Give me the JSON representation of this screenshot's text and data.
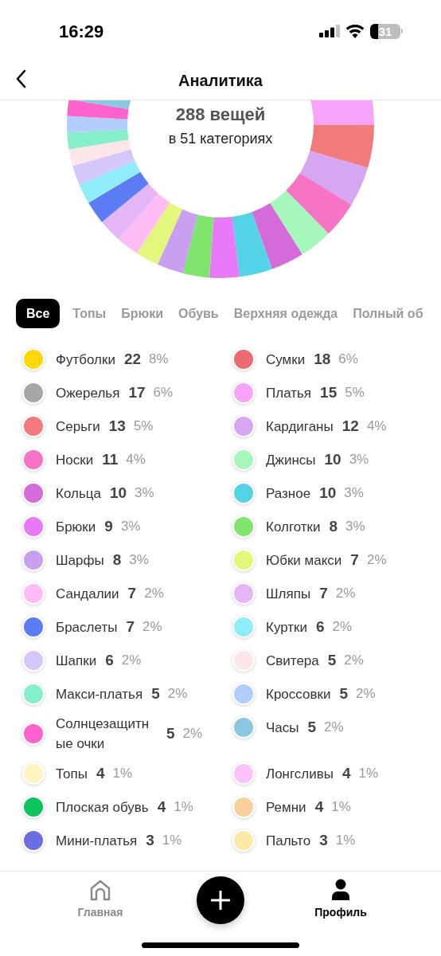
{
  "status_bar": {
    "time": "16:29",
    "battery": "31"
  },
  "header": {
    "title": "Аналитика"
  },
  "summary": {
    "total": "288 вещей",
    "categories": "в 51 категориях"
  },
  "tabs": [
    {
      "label": "Все",
      "selected": true
    },
    {
      "label": "Топы",
      "selected": false
    },
    {
      "label": "Брюки",
      "selected": false
    },
    {
      "label": "Обувь",
      "selected": false
    },
    {
      "label": "Верхняя одежда",
      "selected": false
    },
    {
      "label": "Полный об",
      "selected": false
    }
  ],
  "categories": [
    {
      "name": "Футболки",
      "count": "22",
      "percent": "8%",
      "color": "#ffd60a"
    },
    {
      "name": "Сумки",
      "count": "18",
      "percent": "6%",
      "color": "#ea6b6f"
    },
    {
      "name": "Ожерелья",
      "count": "17",
      "percent": "6%",
      "color": "#a6a6a6"
    },
    {
      "name": "Платья",
      "count": "15",
      "percent": "5%",
      "color": "#f7a3f9"
    },
    {
      "name": "Серьги",
      "count": "13",
      "percent": "5%",
      "color": "#f27a7d"
    },
    {
      "name": "Кардиганы",
      "count": "12",
      "percent": "4%",
      "color": "#d5a6f2"
    },
    {
      "name": "Носки",
      "count": "11",
      "percent": "4%",
      "color": "#f774c4"
    },
    {
      "name": "Джинсы",
      "count": "10",
      "percent": "3%",
      "color": "#a6f7bc"
    },
    {
      "name": "Кольца",
      "count": "10",
      "percent": "3%",
      "color": "#d46bd9"
    },
    {
      "name": "Разное",
      "count": "10",
      "percent": "3%",
      "color": "#55d3e6"
    },
    {
      "name": "Брюки",
      "count": "9",
      "percent": "3%",
      "color": "#e879f9"
    },
    {
      "name": "Колготки",
      "count": "8",
      "percent": "3%",
      "color": "#7fe56d"
    },
    {
      "name": "Шарфы",
      "count": "8",
      "percent": "3%",
      "color": "#c9a0ef"
    },
    {
      "name": "Юбки макси",
      "count": "7",
      "percent": "2%",
      "color": "#e3f77a"
    },
    {
      "name": "Сандалии",
      "count": "7",
      "percent": "2%",
      "color": "#fdbcf4"
    },
    {
      "name": "Шляпы",
      "count": "7",
      "percent": "2%",
      "color": "#e4b6f5"
    },
    {
      "name": "Браслеты",
      "count": "7",
      "percent": "2%",
      "color": "#5b7cf5"
    },
    {
      "name": "Куртки",
      "count": "6",
      "percent": "2%",
      "color": "#8fedf9"
    },
    {
      "name": "Шапки",
      "count": "6",
      "percent": "2%",
      "color": "#d4c8fb"
    },
    {
      "name": "Свитера",
      "count": "5",
      "percent": "2%",
      "color": "#fde6e8"
    },
    {
      "name": "Макси-платья",
      "count": "5",
      "percent": "2%",
      "color": "#85efca"
    },
    {
      "name": "Кроссовки",
      "count": "5",
      "percent": "2%",
      "color": "#b0cdfb"
    },
    {
      "name": "Солнцезащитные очки",
      "count": "5",
      "percent": "2%",
      "color": "#fb62cc"
    },
    {
      "name": "Часы",
      "count": "5",
      "percent": "2%",
      "color": "#89c8e0"
    },
    {
      "name": "Топы",
      "count": "4",
      "percent": "1%",
      "color": "#fdf4c0"
    },
    {
      "name": "Лонгсливы",
      "count": "4",
      "percent": "1%",
      "color": "#fcc3fb"
    },
    {
      "name": "Плоская обувь",
      "count": "4",
      "percent": "1%",
      "color": "#0cc65d"
    },
    {
      "name": "Ремни",
      "count": "4",
      "percent": "1%",
      "color": "#f6cf9c"
    },
    {
      "name": "Мини-платья",
      "count": "3",
      "percent": "1%",
      "color": "#6b6ee0"
    },
    {
      "name": "Пальто",
      "count": "3",
      "percent": "1%",
      "color": "#fde9a6"
    }
  ],
  "bottom_nav": [
    {
      "kind": "tab",
      "label": "Главная",
      "selected": false
    },
    {
      "kind": "add"
    },
    {
      "kind": "tab",
      "label": "Профиль",
      "selected": true
    }
  ]
}
